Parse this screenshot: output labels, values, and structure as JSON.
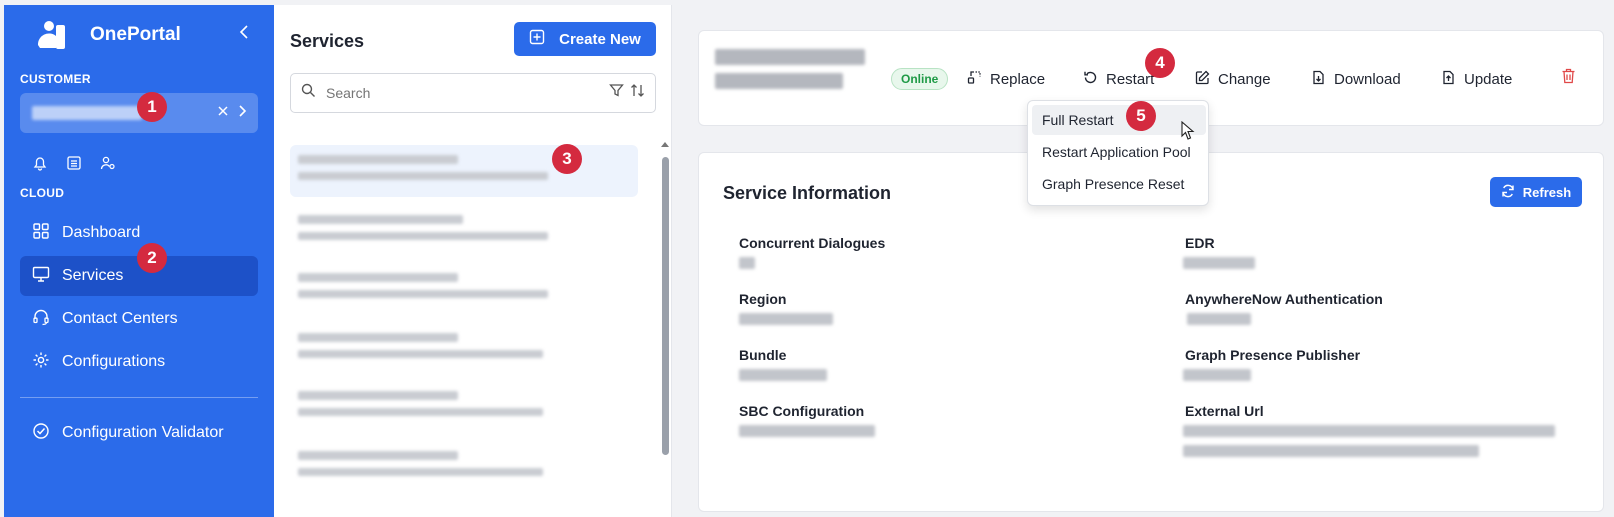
{
  "app": {
    "name": "OnePortal",
    "accent_color": "#2b6bea",
    "marker_color": "#d42a3f"
  },
  "sidebar": {
    "customer_section": "CUSTOMER",
    "cloud_section": "CLOUD",
    "customer_selected_value": "",
    "quick_icons": [
      "bell-icon",
      "list-icon",
      "user-settings-icon"
    ],
    "nav_items": [
      {
        "label": "Dashboard",
        "icon": "grid-icon"
      },
      {
        "label": "Services",
        "icon": "monitor-icon",
        "active": true
      },
      {
        "label": "Contact Centers",
        "icon": "headset-icon"
      },
      {
        "label": "Configurations",
        "icon": "gear-icon"
      }
    ],
    "footer_item": {
      "label": "Configuration Validator",
      "icon": "check-circle-icon"
    }
  },
  "service_list": {
    "title": "Services",
    "create_button": "Create New",
    "search_placeholder": "Search",
    "item_count": 6
  },
  "service_header": {
    "status": "Online",
    "actions": [
      "Replace",
      "Restart",
      "Change",
      "Download",
      "Update"
    ]
  },
  "restart_menu": {
    "items": [
      "Full Restart",
      "Restart Application Pool",
      "Graph Presence Reset"
    ],
    "hovered_index": 0
  },
  "service_info": {
    "title": "Service Information",
    "refresh_button": "Refresh",
    "left_fields": [
      "Concurrent Dialogues",
      "Region",
      "Bundle",
      "SBC Configuration"
    ],
    "right_fields": [
      "EDR",
      "AnywhereNow Authentication",
      "Graph Presence Publisher",
      "External Url"
    ]
  },
  "markers": [
    "1",
    "2",
    "3",
    "4",
    "5"
  ]
}
